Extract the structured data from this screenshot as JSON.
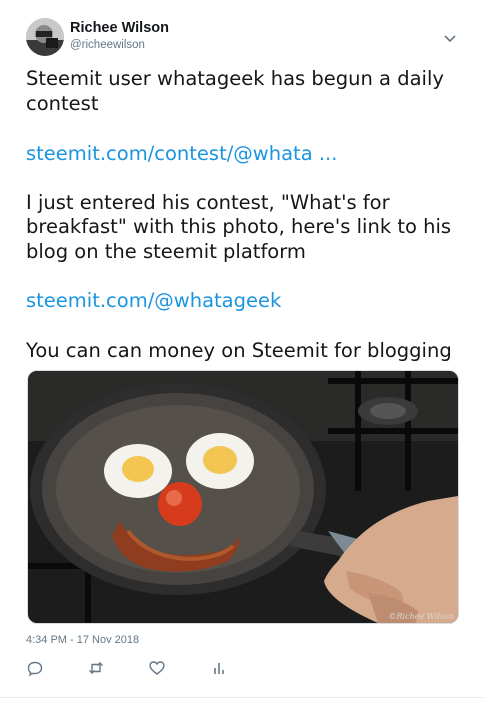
{
  "author": {
    "name": "Richee Wilson",
    "handle": "@richeewilson"
  },
  "tweet": {
    "line1": "Steemit user whatageek has begun a daily",
    "line2": "contest",
    "link1": "steemit.com/contest/@whata  ...",
    "para2_line1": "I just entered his contest, \"What's for",
    "para2_line2": "breakfast\" with this photo, here's link to his",
    "para2_line3": "blog on the steemit platform",
    "link2": "steemit.com/@whatageek",
    "para3": "You can can money on Steemit for blogging"
  },
  "photo": {
    "watermark": "©Richee Wilson"
  },
  "timestamp": "4:34 PM - 17 Nov 2018",
  "icons": {
    "menu": "chevron-down-icon",
    "reply": "reply-icon",
    "retweet": "retweet-icon",
    "like": "heart-icon",
    "analytics": "analytics-icon"
  },
  "colors": {
    "link": "#1b95e0",
    "secondary": "#657786",
    "text": "#14171a"
  }
}
